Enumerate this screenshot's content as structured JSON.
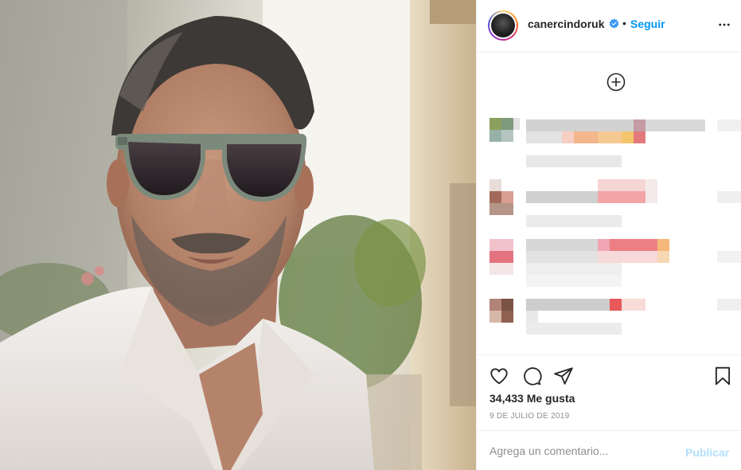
{
  "post": {
    "username": "canercindoruk",
    "verified": true,
    "separator": "•",
    "follow_label": "Seguir",
    "likes_text": "34,433 Me gusta",
    "date_text": "9 DE JULIO DE 2019"
  },
  "comment_box": {
    "placeholder": "Agrega un comentario...",
    "publish_label": "Publicar"
  },
  "icons": {
    "verified": "verified-badge-icon",
    "more": "more-options-icon",
    "add": "add-circle-icon",
    "like": "heart-icon",
    "comment": "comment-icon",
    "share": "paper-plane-icon",
    "save": "bookmark-icon"
  },
  "colors": {
    "link_blue": "#0095f6",
    "publish_disabled": "#b2dffc",
    "muted": "#8e8e8e",
    "text": "#262626",
    "border": "#efefef"
  },
  "photo": {
    "description_visible": false
  }
}
